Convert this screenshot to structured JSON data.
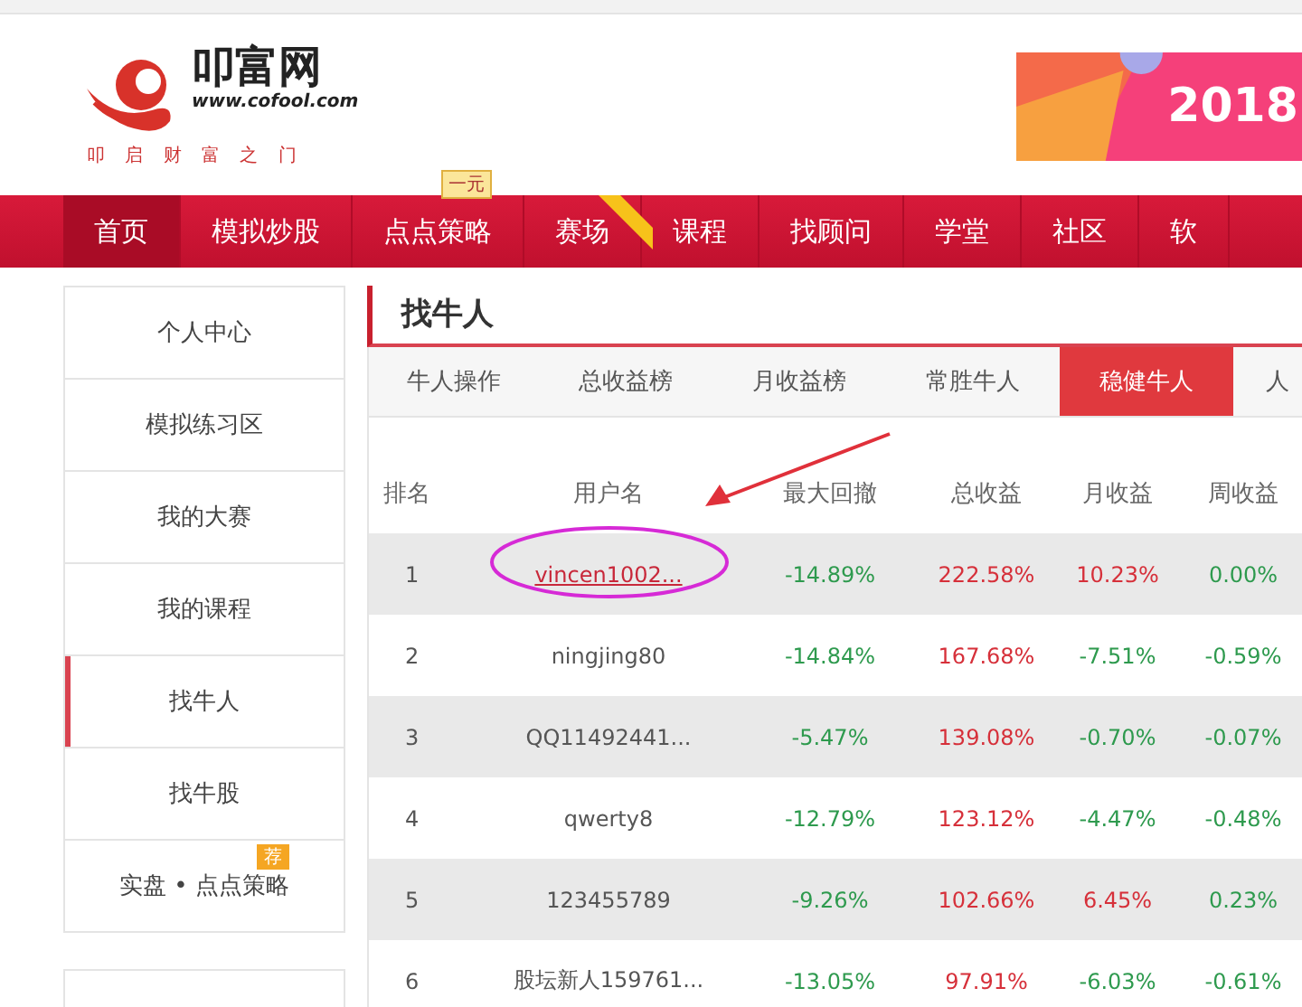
{
  "logo": {
    "name": "叩富网",
    "url": "www.cofool.com",
    "slogan": "叩 启 财 富 之 门"
  },
  "banner": {
    "text": "2018"
  },
  "nav": [
    {
      "label": "首页",
      "selected": true
    },
    {
      "label": "模拟炒股",
      "selected": false
    },
    {
      "label": "点点策略",
      "selected": false,
      "badge": "一元"
    },
    {
      "label": "赛场",
      "selected": false,
      "ribbon": true
    },
    {
      "label": "课程",
      "selected": false
    },
    {
      "label": "找顾问",
      "selected": false
    },
    {
      "label": "学堂",
      "selected": false
    },
    {
      "label": "社区",
      "selected": false
    },
    {
      "label": "软",
      "selected": false
    }
  ],
  "sidebar": [
    {
      "label": "个人中心",
      "selected": false
    },
    {
      "label": "模拟练习区",
      "selected": false
    },
    {
      "label": "我的大赛",
      "selected": false
    },
    {
      "label": "我的课程",
      "selected": false
    },
    {
      "label": "找牛人",
      "selected": true
    },
    {
      "label": "找牛股",
      "selected": false
    },
    {
      "label": "实盘 • 点点策略",
      "selected": false,
      "badge": "荐"
    }
  ],
  "section_title": "找牛人",
  "tabs": [
    {
      "label": "牛人操作",
      "selected": false
    },
    {
      "label": "总收益榜",
      "selected": false
    },
    {
      "label": "月收益榜",
      "selected": false
    },
    {
      "label": "常胜牛人",
      "selected": false
    },
    {
      "label": "稳健牛人",
      "selected": true
    },
    {
      "label": "人",
      "selected": false
    }
  ],
  "table": {
    "columns": [
      "排名",
      "用户名",
      "最大回撤",
      "总收益",
      "月收益",
      "周收益"
    ],
    "rows": [
      {
        "cells": [
          {
            "text": "1"
          },
          {
            "text": "vincen1002...",
            "linked": true,
            "circled": true
          },
          {
            "text": "-14.89%",
            "color": "#2e9a4e"
          },
          {
            "text": "222.58%",
            "color": "#d6303a"
          },
          {
            "text": "10.23%",
            "color": "#d6303a"
          },
          {
            "text": "0.00%",
            "color": "#2e9a4e"
          }
        ]
      },
      {
        "cells": [
          {
            "text": "2"
          },
          {
            "text": "ningjing80",
            "linked": false,
            "circled": false
          },
          {
            "text": "-14.84%",
            "color": "#2e9a4e"
          },
          {
            "text": "167.68%",
            "color": "#d6303a"
          },
          {
            "text": "-7.51%",
            "color": "#2e9a4e"
          },
          {
            "text": "-0.59%",
            "color": "#2e9a4e"
          }
        ]
      },
      {
        "cells": [
          {
            "text": "3"
          },
          {
            "text": "QQ11492441...",
            "linked": false,
            "circled": false
          },
          {
            "text": "-5.47%",
            "color": "#2e9a4e"
          },
          {
            "text": "139.08%",
            "color": "#d6303a"
          },
          {
            "text": "-0.70%",
            "color": "#2e9a4e"
          },
          {
            "text": "-0.07%",
            "color": "#2e9a4e"
          }
        ]
      },
      {
        "cells": [
          {
            "text": "4"
          },
          {
            "text": "qwerty8",
            "linked": false,
            "circled": false
          },
          {
            "text": "-12.79%",
            "color": "#2e9a4e"
          },
          {
            "text": "123.12%",
            "color": "#d6303a"
          },
          {
            "text": "-4.47%",
            "color": "#2e9a4e"
          },
          {
            "text": "-0.48%",
            "color": "#2e9a4e"
          }
        ]
      },
      {
        "cells": [
          {
            "text": "5"
          },
          {
            "text": "123455789",
            "linked": false,
            "circled": false
          },
          {
            "text": "-9.26%",
            "color": "#2e9a4e"
          },
          {
            "text": "102.66%",
            "color": "#d6303a"
          },
          {
            "text": "6.45%",
            "color": "#d6303a"
          },
          {
            "text": "0.23%",
            "color": "#2e9a4e"
          }
        ]
      },
      {
        "cells": [
          {
            "text": "6"
          },
          {
            "text": "股坛新人159761...",
            "linked": false,
            "circled": false
          },
          {
            "text": "-13.05%",
            "color": "#2e9a4e"
          },
          {
            "text": "97.91%",
            "color": "#d6303a"
          },
          {
            "text": "-6.03%",
            "color": "#2e9a4e"
          },
          {
            "text": "-0.61%",
            "color": "#2e9a4e"
          }
        ]
      }
    ]
  },
  "annotation_arrow": true
}
